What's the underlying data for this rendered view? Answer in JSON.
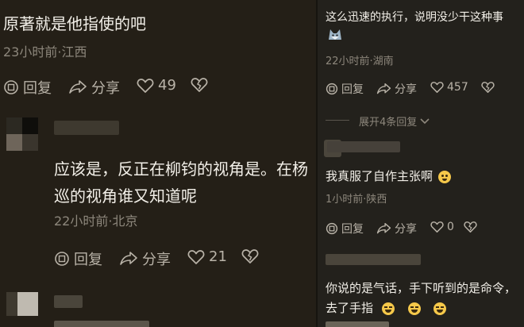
{
  "left": {
    "c1": {
      "text": "原著就是他指使的吧",
      "meta": "23小时前·江西",
      "reply": "回复",
      "share": "分享",
      "likes": "49"
    },
    "c2": {
      "line1": "应该是，反正在柳钧的视角是。在杨",
      "line2": "巡的视角谁又知道呢",
      "meta": "22小时前·北京",
      "reply": "回复",
      "share": "分享",
      "likes": "21"
    }
  },
  "right": {
    "r1": {
      "text": "这么迅速的执行，说明没少干这种事",
      "meta": "22小时前·湖南",
      "reply": "回复",
      "share": "分享",
      "likes": "457"
    },
    "expand": "展开4条回复",
    "r2": {
      "text": "我真服了自作主张啊",
      "meta": "1小时前·陕西",
      "reply": "回复",
      "share": "分享",
      "likes": "0"
    },
    "r3": {
      "line1": "你说的是气话，手下听到的是命令，",
      "line2": "去了手指"
    }
  },
  "colors": {
    "like_outline": "#b9b3a8",
    "emoji": "#f5c84a"
  },
  "icons": [
    "reply-icon",
    "share-icon",
    "heart-icon",
    "broken-heart-icon",
    "chevron-down-icon",
    "wolf-sticker-icon",
    "emoji-icon"
  ]
}
